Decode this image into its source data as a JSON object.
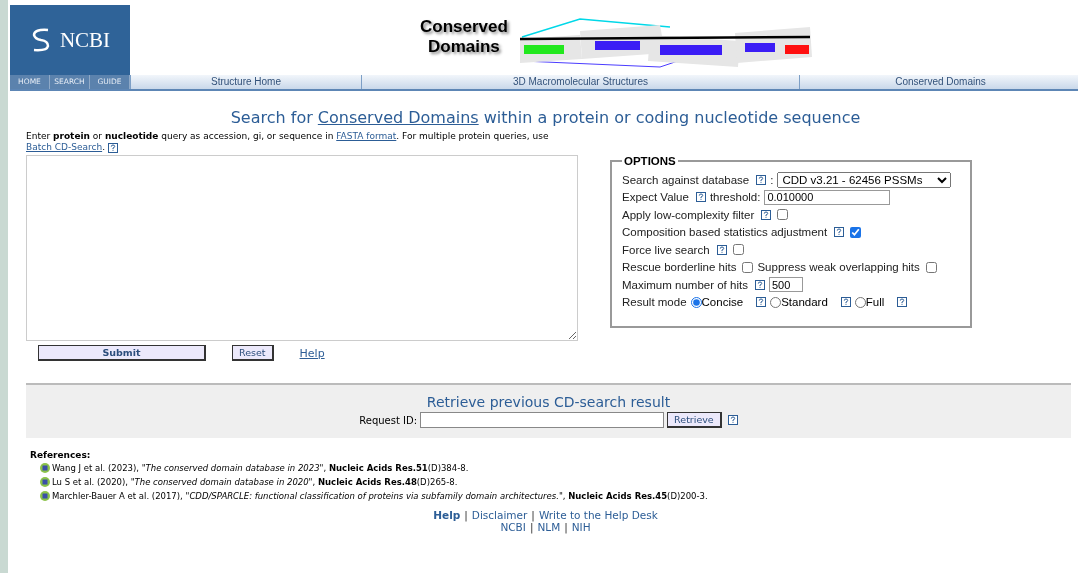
{
  "header": {
    "logo": {
      "text": "NCBI"
    },
    "banner": {
      "title_lines": [
        "Conserved",
        "Domains"
      ]
    }
  },
  "nav": {
    "small_tabs": [
      "HOME",
      "SEARCH",
      "GUIDE"
    ],
    "tabs": [
      "Structure Home",
      "3D Macromolecular Structures",
      "Conserved Domains"
    ]
  },
  "title": {
    "parts": [
      {
        "kind": "text",
        "text": "Search for "
      },
      {
        "kind": "link",
        "text": "Conserved Domains"
      },
      {
        "kind": "text",
        "text": " within a protein or coding nucleotide sequence"
      }
    ]
  },
  "intro": {
    "parts": [
      {
        "kind": "text",
        "text": "Enter **protein** or **nucleotide** query as accession, gi, or sequence in "
      },
      {
        "kind": "link",
        "text": "FASTA format"
      },
      {
        "kind": "text",
        "text": ". For multiple protein queries, use "
      },
      {
        "kind": "link",
        "text": "Batch CD-Search"
      },
      {
        "kind": "text",
        "text": "."
      },
      {
        "kind": "help"
      }
    ]
  },
  "form_buttons": [
    {
      "kind": "primary",
      "label": "Submit"
    },
    {
      "kind": "secondary",
      "label": "Reset"
    },
    {
      "kind": "link",
      "label": "Help"
    }
  ],
  "options": {
    "legend": "OPTIONS",
    "rows": [
      {
        "items": [
          {
            "kind": "label",
            "text": "Search against database"
          },
          {
            "kind": "help"
          },
          {
            "kind": "label",
            "text": ":"
          },
          {
            "kind": "select",
            "value": "CDD v3.21 - 62456 PSSMs"
          }
        ]
      },
      {
        "items": [
          {
            "kind": "label",
            "text": "Expect Value"
          },
          {
            "kind": "help"
          },
          {
            "kind": "label",
            "text": "threshold:"
          },
          {
            "kind": "input",
            "value": "0.010000"
          }
        ]
      },
      {
        "items": [
          {
            "kind": "label",
            "text": "Apply low-complexity filter"
          },
          {
            "kind": "help"
          },
          {
            "kind": "checkbox",
            "checked": false
          }
        ]
      },
      {
        "items": [
          {
            "kind": "label",
            "text": "Composition based statistics adjustment"
          },
          {
            "kind": "help"
          },
          {
            "kind": "checkbox",
            "checked": true
          }
        ]
      },
      {
        "items": [
          {
            "kind": "label",
            "text": "Force live search"
          },
          {
            "kind": "help"
          },
          {
            "kind": "checkbox",
            "checked": false
          }
        ]
      },
      {
        "items": [
          {
            "kind": "label",
            "text": "Rescue borderline hits"
          },
          {
            "kind": "checkbox",
            "checked": false
          },
          {
            "kind": "label",
            "text": "Suppress weak overlapping hits"
          },
          {
            "kind": "checkbox",
            "checked": false
          }
        ]
      },
      {
        "items": [
          {
            "kind": "label",
            "text": "Maximum number of hits"
          },
          {
            "kind": "help"
          },
          {
            "kind": "number",
            "value": "500"
          }
        ]
      },
      {
        "items": [
          {
            "kind": "label",
            "text": "Result mode"
          },
          {
            "kind": "radio",
            "text": "Concise",
            "selected": true
          },
          {
            "kind": "help"
          },
          {
            "kind": "radio",
            "text": "Standard",
            "selected": false
          },
          {
            "kind": "help"
          },
          {
            "kind": "radio",
            "text": "Full",
            "selected": false
          },
          {
            "kind": "help"
          }
        ]
      }
    ]
  },
  "retrieve": {
    "title": "Retrieve previous CD-search result",
    "label": "Request ID:",
    "button": "Retrieve"
  },
  "references": {
    "heading": "References:",
    "items": [
      "Wang J et al. (2023), *\"The conserved domain database in 2023\"*, **Nucleic Acids Res.51**(D)384-8.",
      "Lu S et al. (2020), *\"The conserved domain database in 2020\"*, **Nucleic Acids Res.48**(D)265-8.",
      "Marchler-Bauer A et al. (2017), *\"CDD/SPARCLE: functional classification of proteins via subfamily domain architectures.\"*, **Nucleic Acids Res.45**(D)200-3."
    ]
  },
  "footer": {
    "lines": [
      {
        "links": [
          {
            "kind": "strong-link",
            "text": "Help"
          },
          {
            "kind": "separator",
            "text": "|"
          },
          {
            "kind": "link",
            "text": "Disclaimer"
          },
          {
            "kind": "separator",
            "text": "|"
          },
          {
            "kind": "link",
            "text": "Write to the Help Desk"
          }
        ]
      },
      {
        "links": [
          {
            "kind": "link",
            "text": "NCBI"
          },
          {
            "kind": "separator",
            "text": "|"
          },
          {
            "kind": "link",
            "text": "NLM"
          },
          {
            "kind": "separator",
            "text": "|"
          },
          {
            "kind": "link",
            "text": "NIH"
          }
        ]
      }
    ]
  }
}
